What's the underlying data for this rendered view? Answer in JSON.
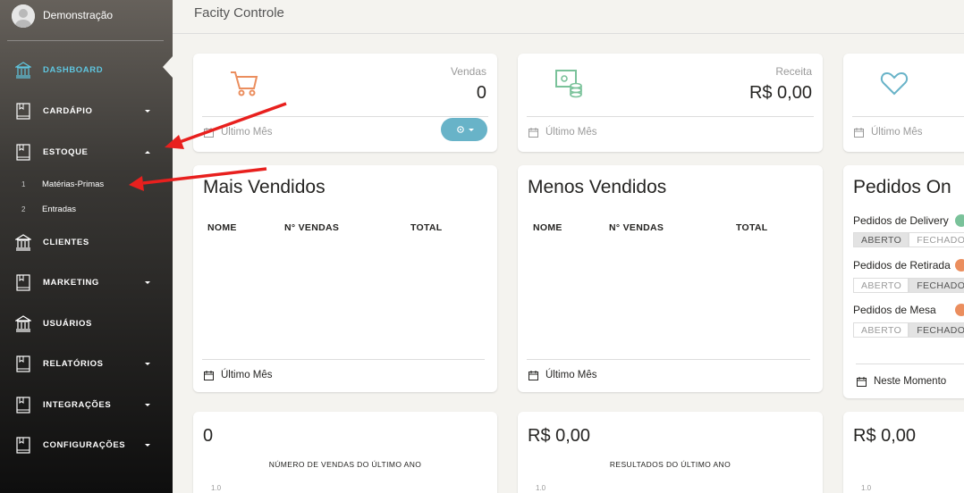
{
  "user": {
    "name": "Demonstração"
  },
  "app": {
    "title": "Facity Controle"
  },
  "sidebar": {
    "items": [
      {
        "label": "DASHBOARD",
        "icon": "bank-icon"
      },
      {
        "label": "CARDÁPIO",
        "icon": "book-icon"
      },
      {
        "label": "ESTOQUE",
        "icon": "book-icon"
      },
      {
        "label": "CLIENTES",
        "icon": "bank-icon"
      },
      {
        "label": "MARKETING",
        "icon": "book-icon"
      },
      {
        "label": "USUÁRIOS",
        "icon": "bank-icon"
      },
      {
        "label": "RELATÓRIOS",
        "icon": "book-icon"
      },
      {
        "label": "INTEGRAÇÕES",
        "icon": "book-icon"
      },
      {
        "label": "CONFIGURAÇÕES",
        "icon": "book-icon"
      }
    ],
    "estoque_sub": [
      {
        "num": "1",
        "label": "Matérias-Primas"
      },
      {
        "num": "2",
        "label": "Entradas"
      }
    ]
  },
  "stats": {
    "vendas": {
      "label": "Vendas",
      "value": "0",
      "footer": "Último Mês"
    },
    "receita": {
      "label": "Receita",
      "value": "R$ 0,00",
      "footer": "Último Mês"
    },
    "third": {
      "footer": "Último Mês"
    }
  },
  "mais_vendidos": {
    "title": "Mais Vendidos",
    "columns": [
      "NOME",
      "N° VENDAS",
      "TOTAL"
    ],
    "footer": "Último Mês"
  },
  "menos_vendidos": {
    "title": "Menos Vendidos",
    "columns": [
      "NOME",
      "N° VENDAS",
      "TOTAL"
    ],
    "footer": "Último Mês"
  },
  "pedidos": {
    "title": "Pedidos On",
    "groups": [
      {
        "label": "Pedidos de Delivery",
        "open": "ABERTO",
        "closed": "FECHADO",
        "selected": "open",
        "dot_color": "#7ac29a"
      },
      {
        "label": "Pedidos de Retirada",
        "open": "ABERTO",
        "closed": "FECHADO",
        "selected": "closed",
        "dot_color": "#eb8e5e"
      },
      {
        "label": "Pedidos de Mesa",
        "open": "ABERTO",
        "closed": "FECHADO",
        "selected": "closed",
        "dot_color": "#eb8e5e"
      }
    ],
    "footer": "Neste Momento"
  },
  "bottom": [
    {
      "value": "0",
      "chart_title": "NÚMERO DE VENDAS DO ÚLTIMO ANO",
      "tick": "1.0"
    },
    {
      "value": "R$ 0,00",
      "chart_title": "RESULTADOS DO ÚLTIMO ANO",
      "tick": "1.0"
    },
    {
      "value": "R$ 0,00",
      "chart_title": "",
      "tick": "1.0"
    }
  ],
  "colors": {
    "accent": "#5fc6e0",
    "cart": "#eb8e5e",
    "money": "#7ac29a",
    "heart": "#68b3c8",
    "button": "#68b3c8",
    "annotation": "#e8201e"
  }
}
